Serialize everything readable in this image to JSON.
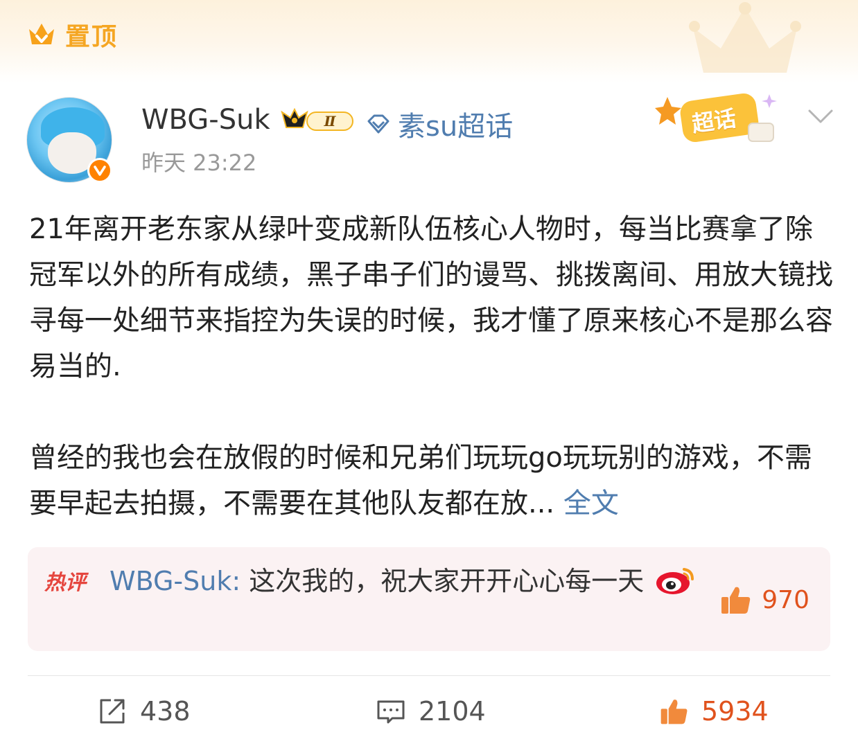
{
  "pin": {
    "label": "置顶",
    "icon": "pinned-crown-icon",
    "color": "#f5a623"
  },
  "author": {
    "name": "WBG-Suk",
    "avatar": "avatar",
    "level_badge": "Ⅱ",
    "verified_icon": "verified-v-icon",
    "topic": "素su超话",
    "time": "昨天 23:22"
  },
  "supertopic_badge": "超话",
  "post": {
    "paragraph1": "21年离开老东家从绿叶变成新队伍核心人物时，每当比赛拿了除冠军以外的所有成绩，黑子串子们的谩骂、挑拨离间、用放大镜找寻每一处细节来指控为失误的时候，我才懂了原来核心不是那么容易当的.",
    "paragraph2": "曾经的我也会在放假的时候和兄弟们玩玩go玩玩别的游戏，不需要早起去拍摄，不需要在其他队友都在放...",
    "more_link": "全文"
  },
  "hot_comment": {
    "label": "热评",
    "user": "WBG-Suk:",
    "text": " 这次我的，祝大家开开心心每一天",
    "emoji": "weibo-logo-emoji",
    "likes": "970"
  },
  "actions": {
    "repost": {
      "icon": "share-icon",
      "count": "438"
    },
    "comment": {
      "icon": "comment-icon",
      "count": "2104"
    },
    "like": {
      "icon": "thumbs-up-icon",
      "count": "5934"
    }
  },
  "colors": {
    "link": "#507daf",
    "accent": "#ff8200",
    "like": "#e0521d"
  }
}
